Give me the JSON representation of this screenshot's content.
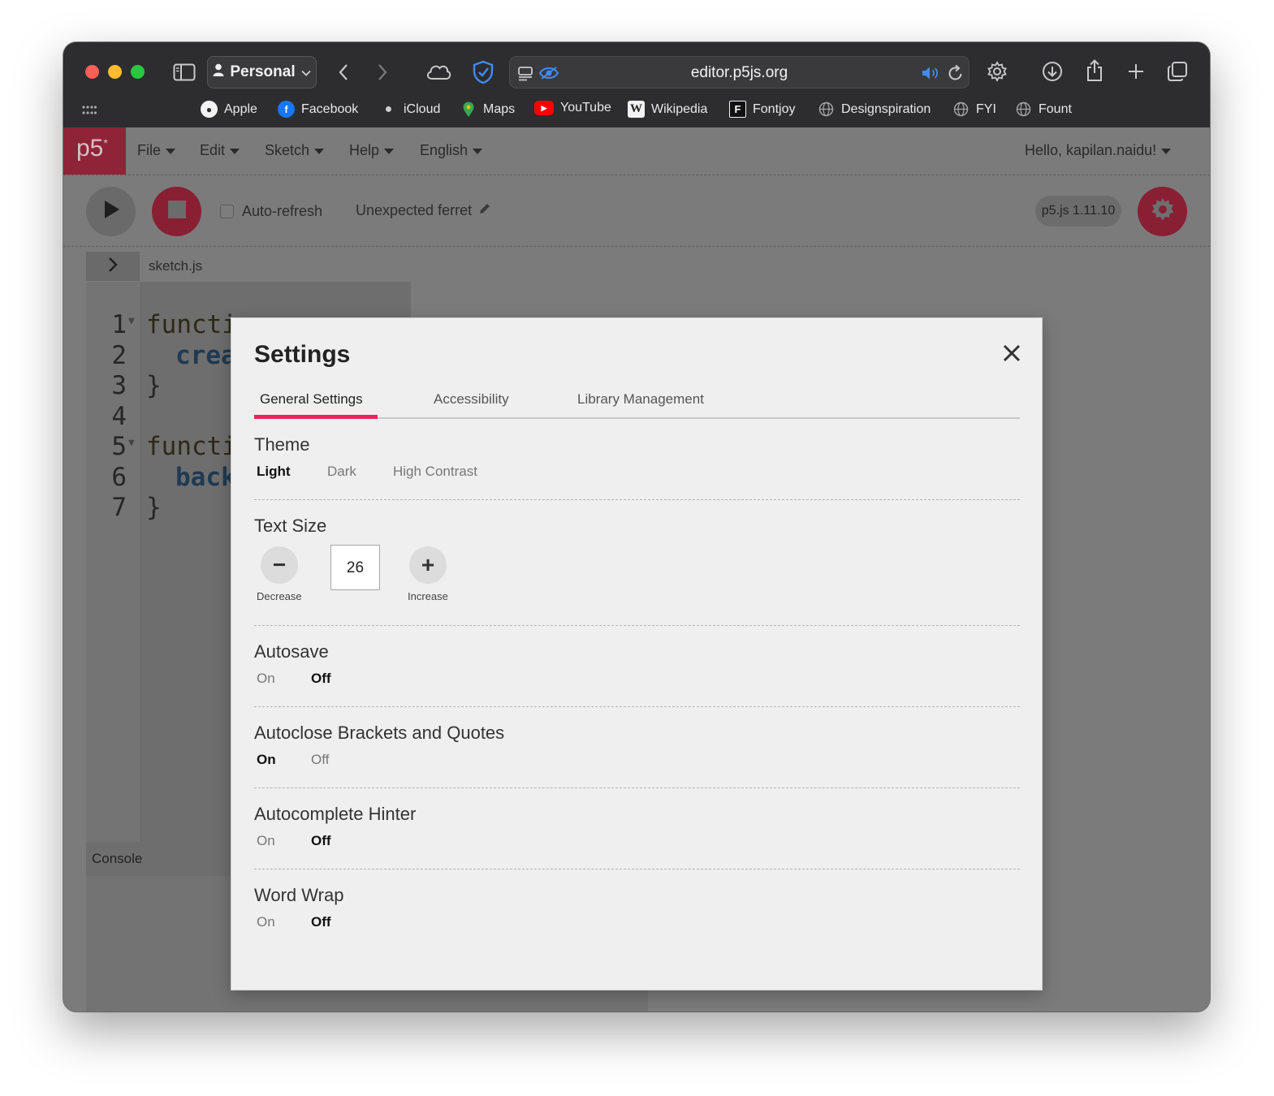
{
  "browser": {
    "profile_label": "Personal",
    "url": "editor.p5js.org",
    "favorites": [
      {
        "label": "Apple",
        "icon": "apple-icon"
      },
      {
        "label": "Facebook",
        "icon": "facebook-icon"
      },
      {
        "label": "iCloud",
        "icon": "icloud-icon"
      },
      {
        "label": "Maps",
        "icon": "maps-icon"
      },
      {
        "label": "YouTube",
        "icon": "youtube-icon"
      },
      {
        "label": "Wikipedia",
        "icon": "wikipedia-icon"
      },
      {
        "label": "Fontjoy",
        "icon": "fontjoy-icon"
      },
      {
        "label": "Designspiration",
        "icon": "globe-icon"
      },
      {
        "label": "FYI",
        "icon": "globe-icon"
      },
      {
        "label": "Fount",
        "icon": "globe-icon"
      }
    ]
  },
  "editor": {
    "logo": "p5",
    "logo_mark": "*",
    "menu": [
      "File",
      "Edit",
      "Sketch",
      "Help",
      "English"
    ],
    "user_greeting": "Hello, kapilan.naidu!",
    "auto_refresh_label": "Auto-refresh",
    "sketch_name": "Unexpected ferret",
    "version_label": "p5.js 1.11.10",
    "file_name": "sketch.js",
    "code_lines": [
      {
        "num": "1",
        "text": "functi",
        "fold": true
      },
      {
        "num": "2",
        "text": "crea",
        "fold": false
      },
      {
        "num": "3",
        "text": "}",
        "fold": false
      },
      {
        "num": "4",
        "text": "",
        "fold": false
      },
      {
        "num": "5",
        "text": "functi",
        "fold": true
      },
      {
        "num": "6",
        "text": "back",
        "fold": false
      },
      {
        "num": "7",
        "text": "}",
        "fold": false
      }
    ],
    "console_label": "Console"
  },
  "settings": {
    "title": "Settings",
    "tabs": [
      "General Settings",
      "Accessibility",
      "Library Management"
    ],
    "active_tab": "General Settings",
    "theme": {
      "title": "Theme",
      "options": [
        "Light",
        "Dark",
        "High Contrast"
      ],
      "selected": "Light"
    },
    "text_size": {
      "title": "Text Size",
      "value": "26",
      "decrease_label": "Decrease",
      "increase_label": "Increase"
    },
    "autosave": {
      "title": "Autosave",
      "on": "On",
      "off": "Off",
      "selected": "Off"
    },
    "autoclose": {
      "title": "Autoclose Brackets and Quotes",
      "on": "On",
      "off": "Off",
      "selected": "On"
    },
    "autocomplete": {
      "title": "Autocomplete Hinter",
      "on": "On",
      "off": "Off",
      "selected": "Off"
    },
    "word_wrap": {
      "title": "Word Wrap",
      "on": "On",
      "off": "Off",
      "selected": "Off"
    }
  },
  "colors": {
    "p5_accent": "#ed225d",
    "p5_red_dimmed": "#891f33",
    "overlay": "#7b7b7b",
    "modal_bg": "#efefef",
    "browser_chrome": "#2d2d2f"
  }
}
